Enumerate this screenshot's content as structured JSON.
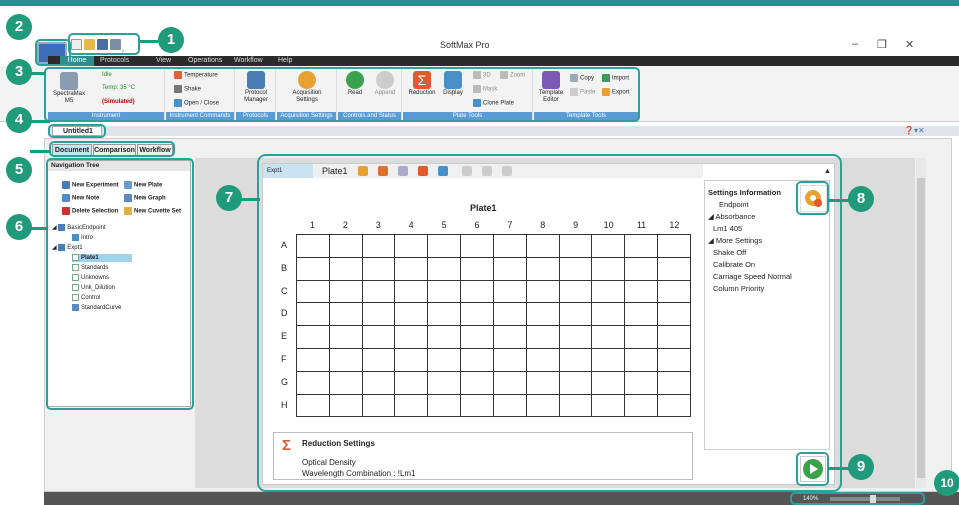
{
  "window": {
    "title": "SoftMax Pro",
    "minimize": "–",
    "maximize": "❐",
    "close": "✕"
  },
  "menu": [
    "Home",
    "Protocols",
    "View",
    "Operations",
    "Workflow",
    "Help"
  ],
  "ribbon": {
    "instrument": {
      "name": "SpectraMax M5",
      "status": "Idle",
      "temp": "Temp: 35 °C",
      "mode": "(Simulated)",
      "group": "Instrument"
    },
    "instrument_commands": {
      "temperature": "Temperature",
      "shake": "Shake",
      "open_close": "Open / Close",
      "group": "Instrument Commands"
    },
    "protocols": {
      "manager": "Protocol Manager",
      "group": "Protocols"
    },
    "acquisition": {
      "settings": "Acquisition Settings",
      "group": "Acquisition Settings"
    },
    "controls": {
      "read": "Read",
      "append": "Append",
      "group": "Controls and Status"
    },
    "plate_tools": {
      "reduction": "Reduction",
      "display": "Display",
      "view3d": "3D",
      "zoom": "Zoom",
      "mask": "Mask",
      "clone": "Clone Plate",
      "group": "Plate Tools"
    },
    "template_tools": {
      "editor": "Template Editor",
      "copy": "Copy",
      "paste": "Paste",
      "import": "Import",
      "export": "Export",
      "group": "Template Tools"
    }
  },
  "document_tab": "Untitled1",
  "view_tabs": [
    "Document",
    "Comparison",
    "Workflow"
  ],
  "nav": {
    "title": "Navigation Tree",
    "actions": [
      "New Experiment",
      "New Plate",
      "New Note",
      "New Graph",
      "Delete Selection",
      "New Cuvette Set"
    ],
    "tree": [
      "BasicEndpoint",
      "Intro",
      "Expt1",
      "Plate1",
      "Standards",
      "Unknowns",
      "Unk_Dilution",
      "Control",
      "StandardCurve"
    ]
  },
  "experiment": {
    "tab": "Expt1",
    "plate_tab": "Plate1"
  },
  "plate": {
    "title": "Plate1",
    "columns": [
      "1",
      "2",
      "3",
      "4",
      "5",
      "6",
      "7",
      "8",
      "9",
      "10",
      "11",
      "12"
    ],
    "rows": [
      "A",
      "B",
      "C",
      "D",
      "E",
      "F",
      "G",
      "H"
    ]
  },
  "settings_info": {
    "title": "Settings Information",
    "lines": [
      "Endpoint",
      "◢ Absorbance",
      "Lm1   405",
      "◢ More Settings",
      "Shake  Off",
      "Calibrate  On",
      "Carriage Speed  Normal",
      "Column Priority"
    ]
  },
  "reduction": {
    "title": "Reduction Settings",
    "line1": "Optical Density",
    "line2": "Wavelength Combination : !Lm1"
  },
  "status": {
    "zoom": "140%"
  },
  "callouts": [
    "1",
    "2",
    "3",
    "4",
    "5",
    "6",
    "7",
    "8",
    "9",
    "10"
  ],
  "colors": {
    "accent": "#2aa29a",
    "callout": "#1f9a7a",
    "menubar": "#2b2b2b"
  }
}
